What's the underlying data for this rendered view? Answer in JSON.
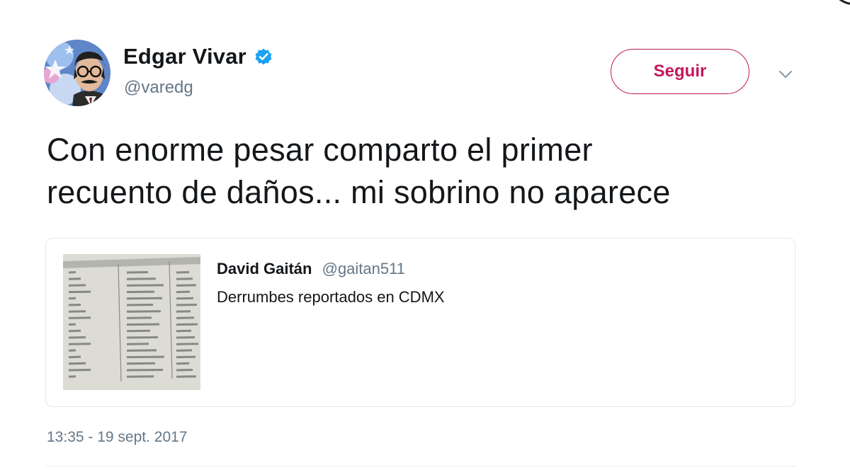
{
  "author": {
    "display_name": "Edgar Vivar",
    "handle": "@varedg",
    "verified": true,
    "verified_icon": "verified-badge-icon",
    "verified_color": "#1da1f2"
  },
  "actions": {
    "follow_label": "Seguir",
    "follow_color": "#c2185b",
    "more_icon": "chevron-down-icon"
  },
  "tweet": {
    "lines": [
      "Con enorme pesar comparto el primer",
      "recuento de daños... mi sobrino no aparece"
    ],
    "timestamp": "13:35 - 19 sept. 2017"
  },
  "quoted": {
    "name": "David Gaitán",
    "handle": "@gaitan511",
    "text": "Derrumbes reportados en CDMX"
  }
}
